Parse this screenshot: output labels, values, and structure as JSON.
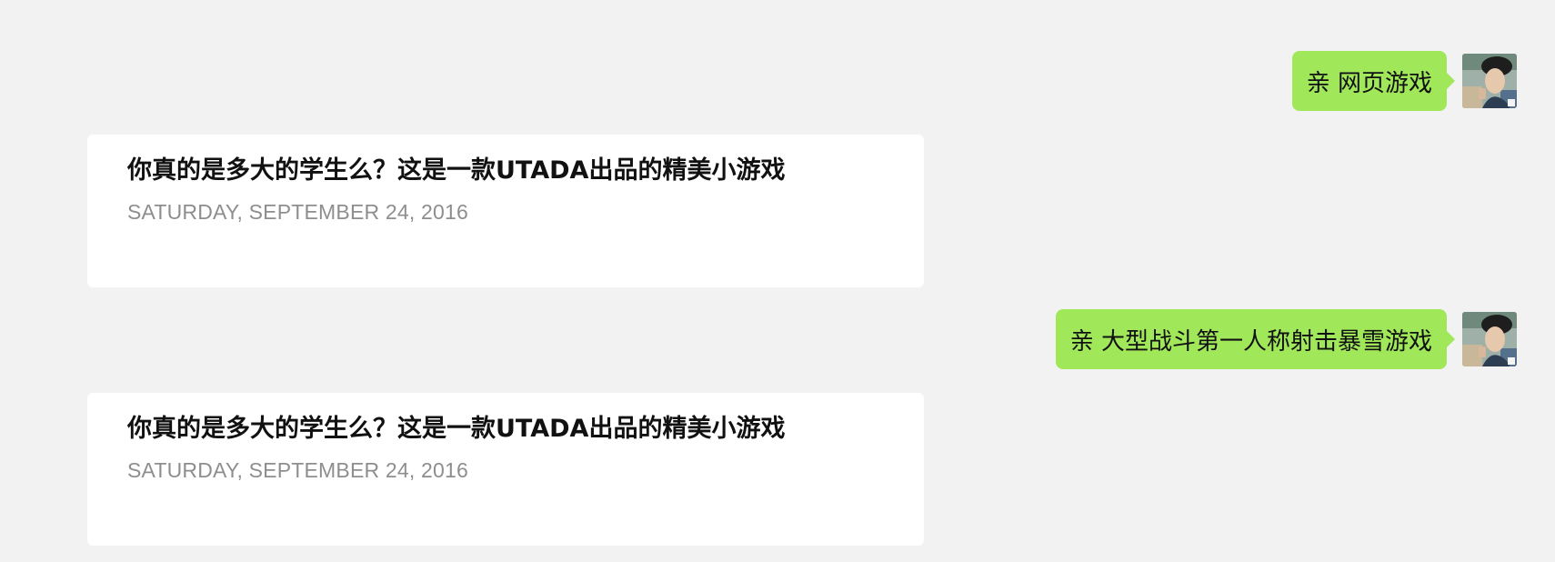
{
  "messages": [
    {
      "direction": "outgoing",
      "text": "亲 网页游戏",
      "avatar_icon": "user-avatar-photo"
    },
    {
      "direction": "incoming",
      "card": {
        "title": "你真的是多大的学生么？这是一款UTADA出品的精美小游戏",
        "date": "SATURDAY, SEPTEMBER 24, 2016"
      }
    },
    {
      "direction": "outgoing",
      "text": "亲 大型战斗第一人称射击暴雪游戏",
      "avatar_icon": "user-avatar-photo"
    },
    {
      "direction": "incoming",
      "card": {
        "title": "你真的是多大的学生么？这是一款UTADA出品的精美小游戏",
        "date": "SATURDAY, SEPTEMBER 24, 2016"
      }
    }
  ],
  "colors": {
    "background": "#f2f2f2",
    "outgoing_bubble": "#a0e75a",
    "card_background": "#ffffff",
    "date_text": "#8e8e8e"
  }
}
